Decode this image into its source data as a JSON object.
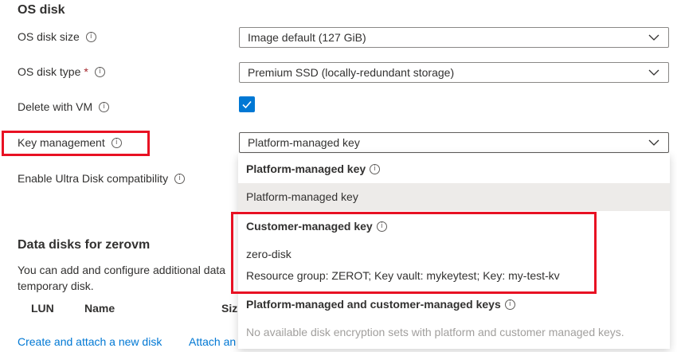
{
  "os_disk": {
    "section_title": "OS disk",
    "size": {
      "label": "OS disk size",
      "value": "Image default (127 GiB)"
    },
    "type": {
      "label": "OS disk type",
      "required_mark": "*",
      "value": "Premium SSD (locally-redundant storage)"
    },
    "delete_with_vm": {
      "label": "Delete with VM",
      "checked": true
    },
    "key_management": {
      "label": "Key management",
      "value": "Platform-managed key",
      "dropdown": {
        "groups": [
          {
            "header": "Platform-managed key",
            "items": [
              {
                "label": "Platform-managed key"
              }
            ]
          },
          {
            "header": "Customer-managed key",
            "items": [
              {
                "label": "zero-disk",
                "detail": "Resource group: ZEROT; Key vault: mykeytest; Key: my-test-kv"
              }
            ]
          },
          {
            "header": "Platform-managed and customer-managed keys",
            "empty_message": "No available disk encryption sets with platform and customer managed keys."
          }
        ]
      }
    },
    "ultra_disk": {
      "label": "Enable Ultra Disk compatibility"
    }
  },
  "data_disks": {
    "section_title": "Data disks for zerovm",
    "description_line1": "You can add and configure additional data",
    "description_line2": "temporary disk.",
    "columns": [
      "LUN",
      "Name",
      "Siz"
    ],
    "links": {
      "create": "Create and attach a new disk",
      "attach": "Attach an"
    }
  },
  "colors": {
    "accent": "#0078d4",
    "highlight": "#e81123",
    "selected_bg": "#edebe9"
  },
  "icons": {
    "info": "info-icon",
    "chevron": "chevron-down-icon",
    "check": "checkmark-icon"
  }
}
